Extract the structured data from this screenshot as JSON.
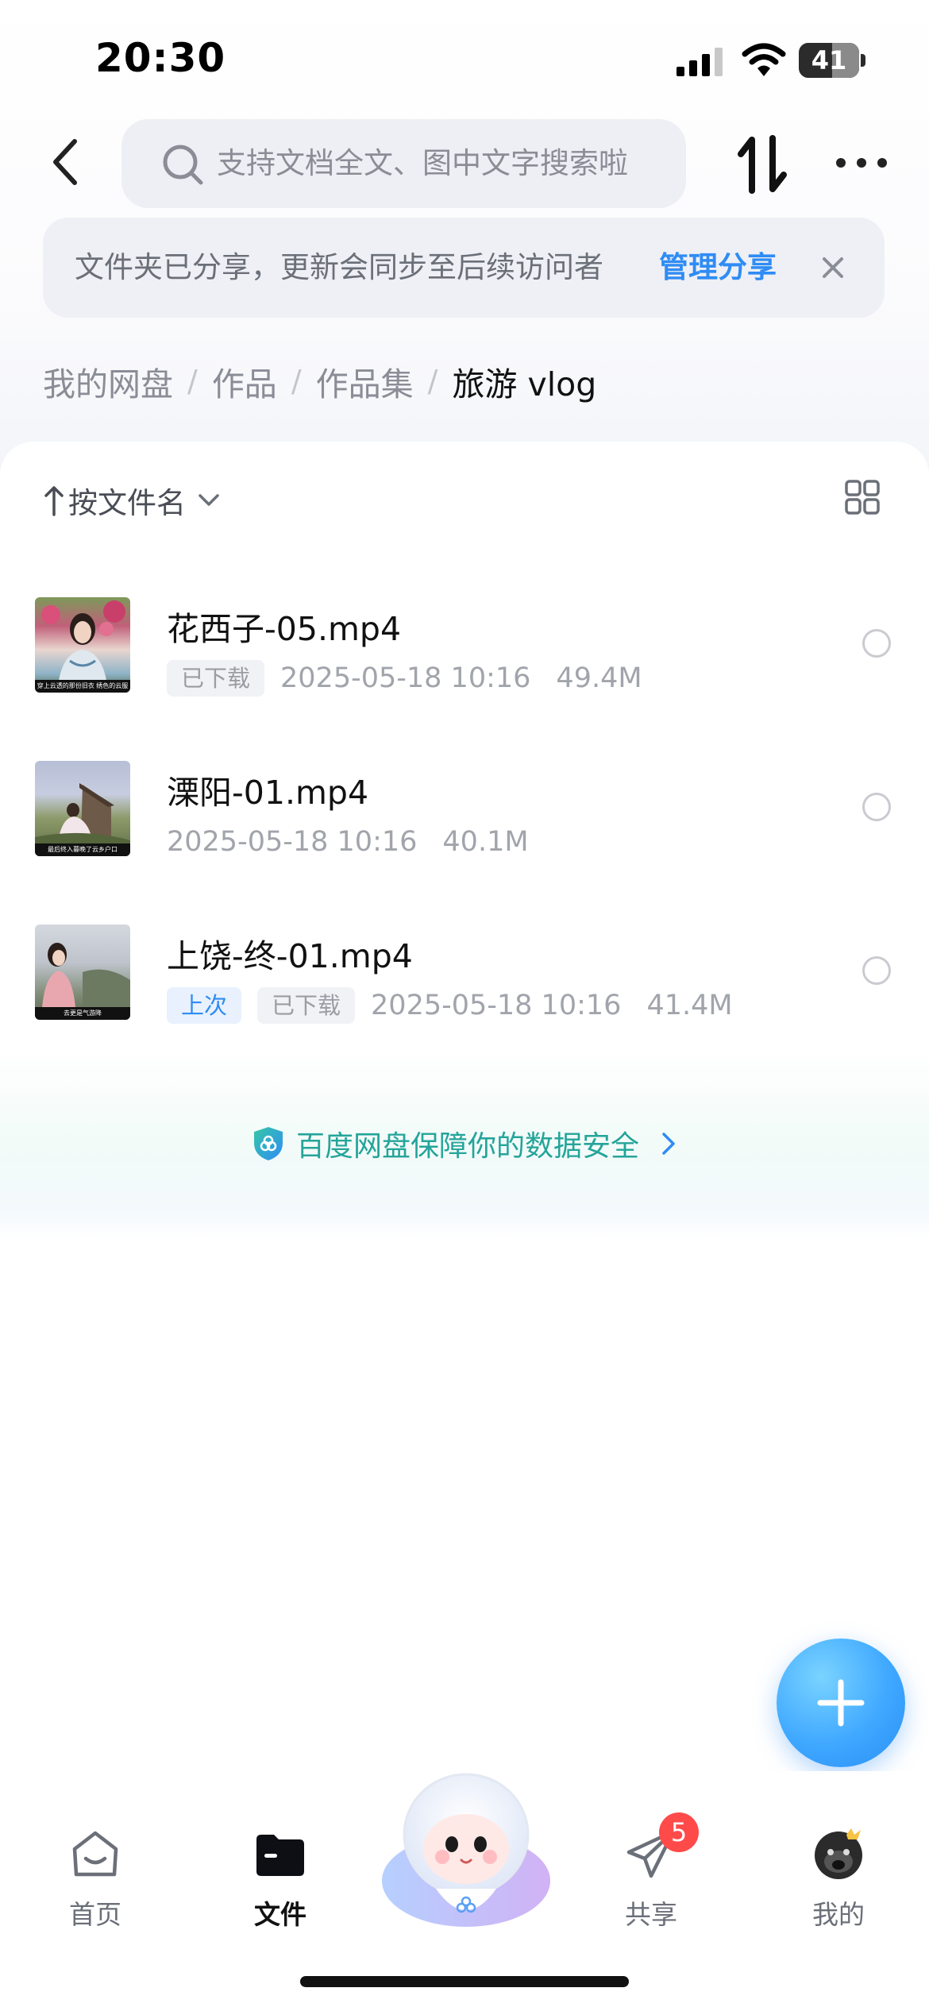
{
  "status_bar": {
    "time": "20:30",
    "battery_level": "41"
  },
  "header": {
    "search_placeholder": "支持文档全文、图中文字搜索啦"
  },
  "share_banner": {
    "text": "文件夹已分享，更新会同步至后续访问者",
    "link": "管理分享"
  },
  "breadcrumb": [
    "我的网盘",
    "作品",
    "作品集",
    "旅游 vlog"
  ],
  "sort": {
    "label": "按文件名"
  },
  "files": [
    {
      "name": "花西子-05.mp4",
      "tags": [
        "已下载"
      ],
      "date": "2025-05-18 10:16",
      "size": "49.4M",
      "thumb_caption": "穿上云透的那份旧衣 绣色的云服"
    },
    {
      "name": "溧阳-01.mp4",
      "tags": [],
      "date": "2025-05-18 10:16",
      "size": "40.1M",
      "thumb_caption": "最后终入暮晚了云乡户口"
    },
    {
      "name": "上饶-终-01.mp4",
      "tags": [
        "上次",
        "已下载"
      ],
      "date": "2025-05-18 10:16",
      "size": "41.4M",
      "thumb_caption": "去更是气游降"
    }
  ],
  "safety": {
    "text": "百度网盘保障你的数据安全"
  },
  "tab_bar": {
    "items": [
      {
        "label": "首页",
        "icon": "home-icon"
      },
      {
        "label": "文件",
        "icon": "folder-icon"
      },
      {
        "label": "共享",
        "icon": "paper-plane-icon",
        "badge": "5"
      },
      {
        "label": "我的",
        "icon": "avatar"
      }
    ]
  },
  "colors": {
    "accent": "#2f8cf5",
    "safety_green": "#25a49a",
    "badge_red": "#ff4a4a"
  }
}
